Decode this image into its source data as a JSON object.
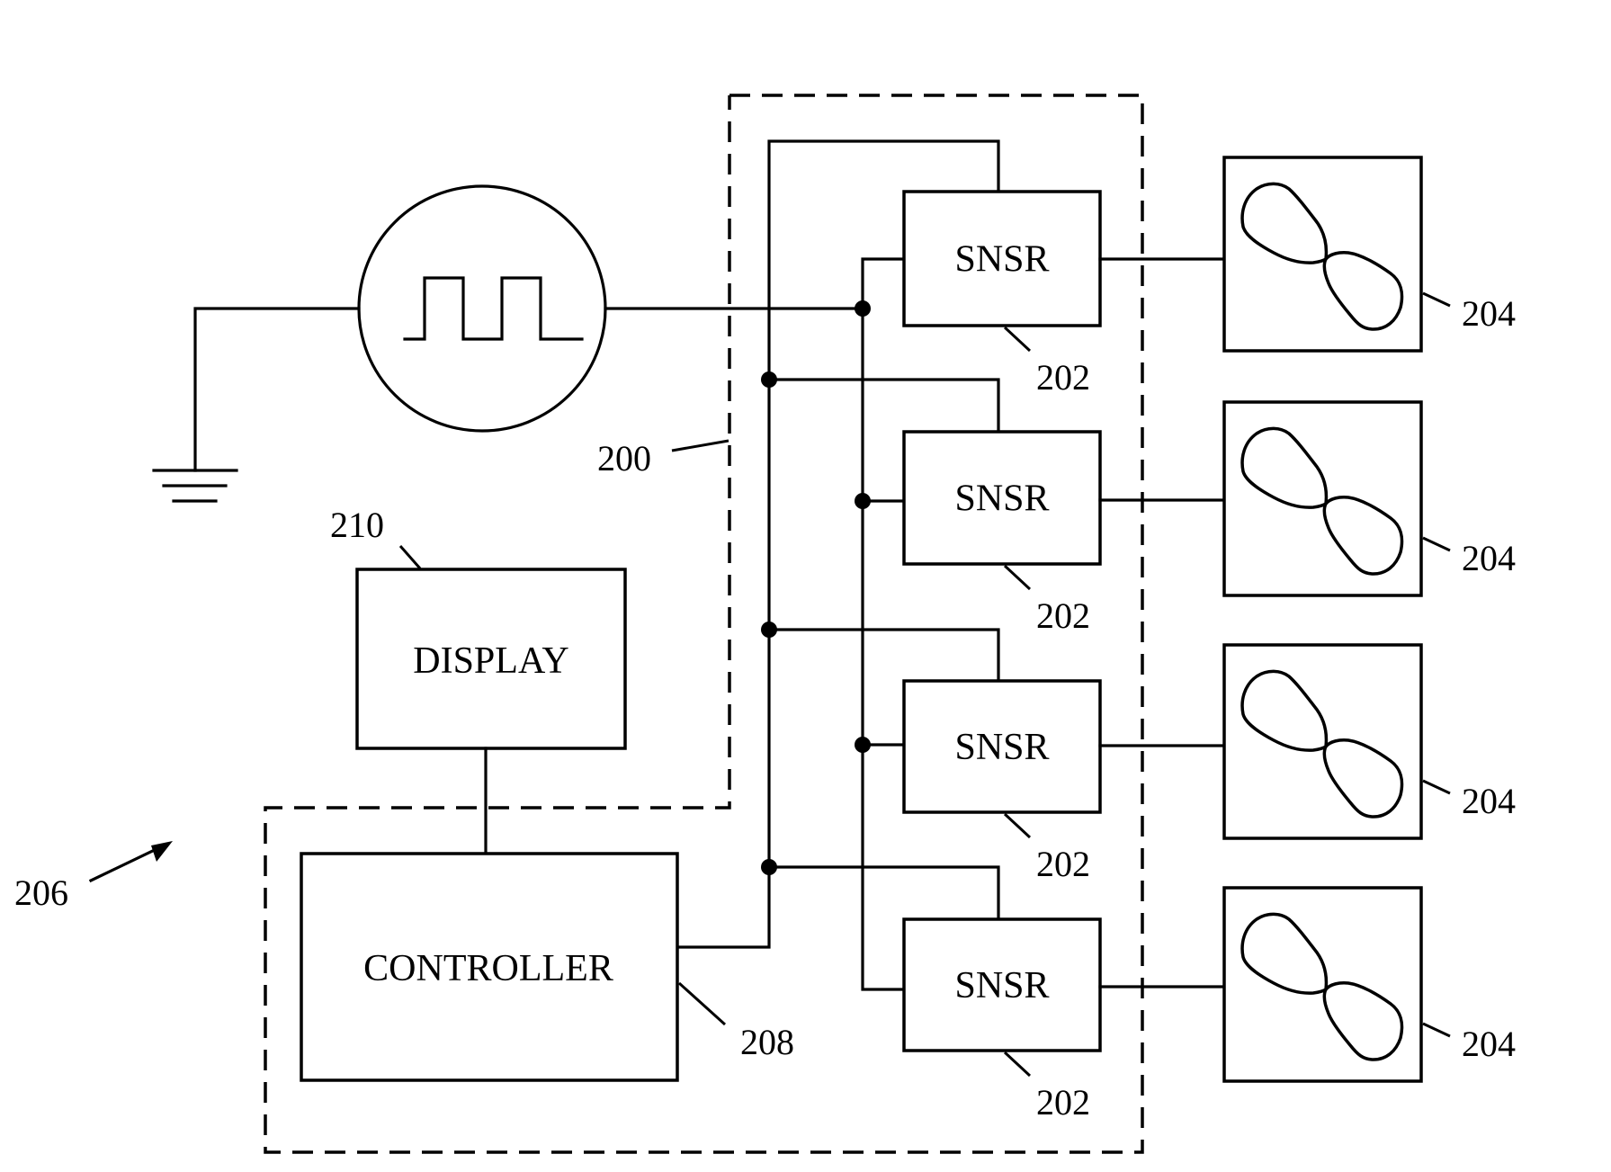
{
  "figure": {
    "type": "block-schematic",
    "source": {
      "name": "pulse-signal-source",
      "symbol": "square-wave-icon",
      "ground_symbol": "ground-icon"
    },
    "region_labels": {
      "sensor_region": "200",
      "system": "206",
      "controller_ref": "208",
      "display_ref": "210"
    },
    "blocks": {
      "display": "DISPLAY",
      "controller": "CONTROLLER"
    },
    "sensors": [
      {
        "label": "SNSR",
        "ref": "202"
      },
      {
        "label": "SNSR",
        "ref": "202"
      },
      {
        "label": "SNSR",
        "ref": "202"
      },
      {
        "label": "SNSR",
        "ref": "202"
      }
    ],
    "fans": [
      {
        "icon": "fan-icon",
        "ref": "204"
      },
      {
        "icon": "fan-icon",
        "ref": "204"
      },
      {
        "icon": "fan-icon",
        "ref": "204"
      },
      {
        "icon": "fan-icon",
        "ref": "204"
      }
    ],
    "colors": {
      "ink": "#000000",
      "background": "#ffffff"
    }
  }
}
